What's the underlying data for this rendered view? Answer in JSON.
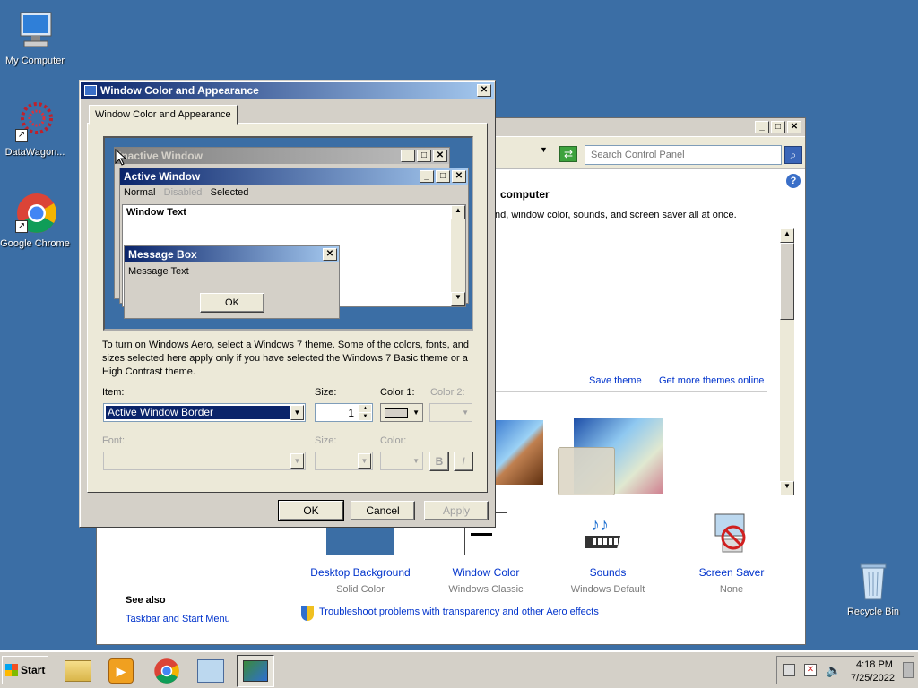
{
  "desktop": {
    "icons": [
      {
        "label": "My Computer",
        "icon": "computer-icon"
      },
      {
        "label": "DataWagon...",
        "icon": "datawagon-icon"
      },
      {
        "label": "Google Chrome",
        "icon": "chrome-icon"
      },
      {
        "label": "Recycle Bin",
        "icon": "recycle-bin-icon"
      }
    ]
  },
  "control_panel": {
    "search_placeholder": "Search Control Panel",
    "heading": "computer",
    "description": "nd, window color, sounds, and screen saver all at once.",
    "save_theme": "Save theme",
    "get_more_themes": "Get more themes online",
    "items": [
      {
        "title": "Desktop Background",
        "subtitle": "Solid Color"
      },
      {
        "title": "Window Color",
        "subtitle": "Windows Classic"
      },
      {
        "title": "Sounds",
        "subtitle": "Windows Default"
      },
      {
        "title": "Screen Saver",
        "subtitle": "None"
      }
    ],
    "see_also": "See also",
    "taskbar_link": "Taskbar and Start Menu",
    "troubleshoot": "Troubleshoot problems with transparency and other Aero effects"
  },
  "dialog": {
    "title": "Window Color and Appearance",
    "tab": "Window Color and Appearance",
    "preview": {
      "inactive_title": "Inactive Window",
      "active_title": "Active Window",
      "menu_normal": "Normal",
      "menu_disabled": "Disabled",
      "menu_selected": "Selected",
      "window_text": "Window Text",
      "msgbox_title": "Message Box",
      "msgbox_text": "Message Text",
      "msgbox_ok": "OK"
    },
    "info": "To turn on Windows Aero, select a Windows 7 theme.  Some of the colors, fonts, and sizes selected here apply only if you have selected the Windows 7 Basic theme or a High Contrast theme.",
    "item_label": "Item:",
    "item_value": "Active Window Border",
    "size_label": "Size:",
    "size_value": "1",
    "color1_label": "Color 1:",
    "color2_label": "Color 2:",
    "color1_value": "#d4d0c8",
    "font_label": "Font:",
    "font_size_label": "Size:",
    "font_color_label": "Color:",
    "bold": "B",
    "italic": "I",
    "ok": "OK",
    "cancel": "Cancel",
    "apply": "Apply"
  },
  "taskbar": {
    "start": "Start",
    "time": "4:18 PM",
    "date": "7/25/2022"
  }
}
